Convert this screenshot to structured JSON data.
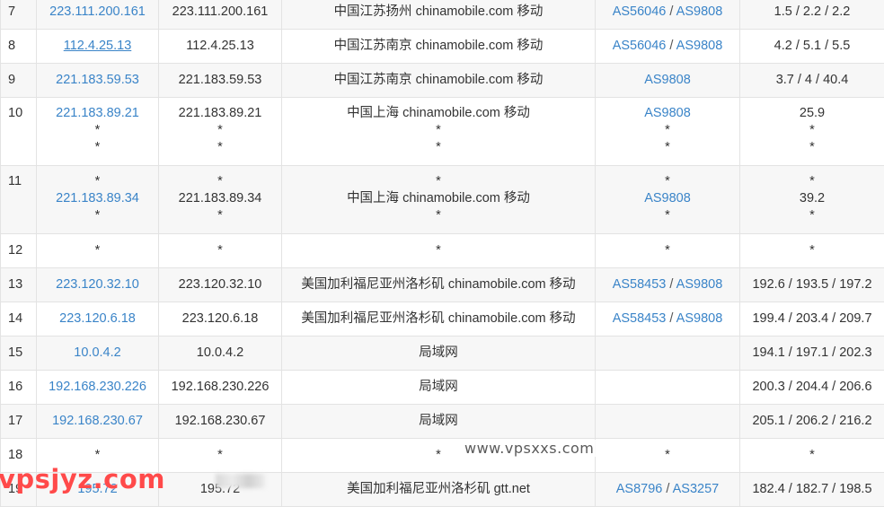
{
  "rows": [
    {
      "hop": "7",
      "ip": [
        "223.111.200.161"
      ],
      "host": [
        "223.111.200.161"
      ],
      "loc": [
        "中国江苏扬州 chinamobile.com 移动"
      ],
      "as": [
        [
          "AS56046",
          "AS9808"
        ]
      ],
      "rtt": [
        "1.5 / 2.2 / 2.2"
      ],
      "ul": false
    },
    {
      "hop": "8",
      "ip": [
        "112.4.25.13"
      ],
      "host": [
        "112.4.25.13"
      ],
      "loc": [
        "中国江苏南京 chinamobile.com 移动"
      ],
      "as": [
        [
          "AS56046",
          "AS9808"
        ]
      ],
      "rtt": [
        "4.2 / 5.1 / 5.5"
      ],
      "ul": true
    },
    {
      "hop": "9",
      "ip": [
        "221.183.59.53"
      ],
      "host": [
        "221.183.59.53"
      ],
      "loc": [
        "中国江苏南京 chinamobile.com 移动"
      ],
      "as": [
        [
          "AS9808"
        ]
      ],
      "rtt": [
        "3.7 / 4 / 40.4"
      ],
      "ul": false
    },
    {
      "hop": "10",
      "ip": [
        "221.183.89.21",
        "*",
        "*"
      ],
      "host": [
        "221.183.89.21",
        "*",
        "*"
      ],
      "loc": [
        "中国上海 chinamobile.com 移动",
        "*",
        "*"
      ],
      "as": [
        [
          "AS9808"
        ],
        [
          "*"
        ],
        [
          "*"
        ]
      ],
      "rtt": [
        "25.9",
        "*",
        "*"
      ],
      "ul": false
    },
    {
      "hop": "11",
      "ip": [
        "*",
        "221.183.89.34",
        "*"
      ],
      "host": [
        "*",
        "221.183.89.34",
        "*"
      ],
      "loc": [
        "*",
        "中国上海 chinamobile.com 移动",
        "*"
      ],
      "as": [
        [
          "*"
        ],
        [
          "AS9808"
        ],
        [
          "*"
        ]
      ],
      "rtt": [
        "*",
        "39.2",
        "*"
      ],
      "ul": false
    },
    {
      "hop": "12",
      "ip": [
        "*"
      ],
      "host": [
        "*"
      ],
      "loc": [
        "*"
      ],
      "as": [
        [
          "*"
        ]
      ],
      "rtt": [
        "*"
      ],
      "ul": false
    },
    {
      "hop": "13",
      "ip": [
        "223.120.32.10"
      ],
      "host": [
        "223.120.32.10"
      ],
      "loc": [
        "美国加利福尼亚州洛杉矶 chinamobile.com 移动"
      ],
      "as": [
        [
          "AS58453",
          "AS9808"
        ]
      ],
      "rtt": [
        "192.6 / 193.5 / 197.2"
      ],
      "ul": false
    },
    {
      "hop": "14",
      "ip": [
        "223.120.6.18"
      ],
      "host": [
        "223.120.6.18"
      ],
      "loc": [
        "美国加利福尼亚州洛杉矶 chinamobile.com 移动"
      ],
      "as": [
        [
          "AS58453",
          "AS9808"
        ]
      ],
      "rtt": [
        "199.4 / 203.4 / 209.7"
      ],
      "ul": false
    },
    {
      "hop": "15",
      "ip": [
        "10.0.4.2"
      ],
      "host": [
        "10.0.4.2"
      ],
      "loc": [
        "局域网"
      ],
      "as": [
        []
      ],
      "rtt": [
        "194.1 / 197.1 / 202.3"
      ],
      "ul": false
    },
    {
      "hop": "16",
      "ip": [
        "192.168.230.226"
      ],
      "host": [
        "192.168.230.226"
      ],
      "loc": [
        "局域网"
      ],
      "as": [
        []
      ],
      "rtt": [
        "200.3 / 204.4 / 206.6"
      ],
      "ul": false
    },
    {
      "hop": "17",
      "ip": [
        "192.168.230.67"
      ],
      "host": [
        "192.168.230.67"
      ],
      "loc": [
        "局域网"
      ],
      "as": [
        []
      ],
      "rtt": [
        "205.1 / 206.2 / 216.2"
      ],
      "ul": false
    },
    {
      "hop": "18",
      "ip": [
        "*"
      ],
      "host": [
        "*"
      ],
      "loc": [
        "*"
      ],
      "as": [
        [
          "*"
        ]
      ],
      "rtt": [
        "*"
      ],
      "ul": false
    },
    {
      "hop": "19",
      "ip": [
        "195.72"
      ],
      "host": [
        "195.72"
      ],
      "loc": [
        "美国加利福尼亚州洛杉矶 gtt.net"
      ],
      "as": [
        [
          "AS8796",
          "AS3257"
        ]
      ],
      "rtt": [
        "182.4 / 182.7 / 198.5"
      ],
      "ul": false
    }
  ],
  "watermarks": {
    "site": "www.vpsxxs.com",
    "brand": "vpsjyz.com"
  }
}
